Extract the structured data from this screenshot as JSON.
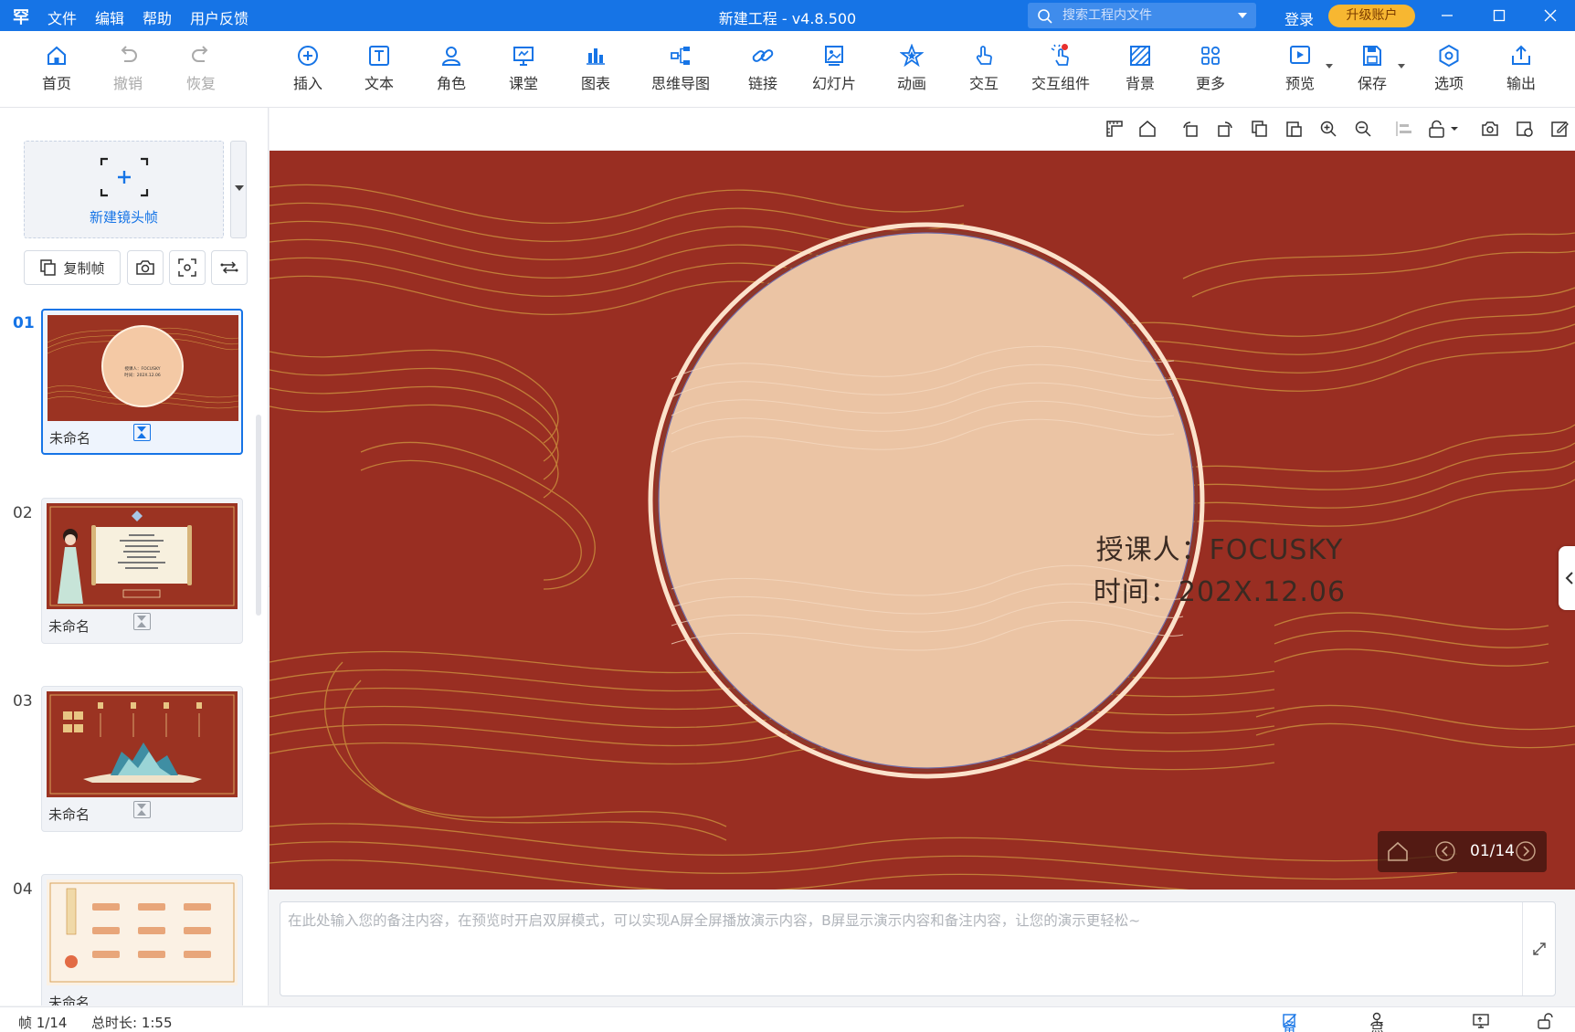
{
  "app": {
    "logo": "罕",
    "title": "新建工程 - v4.8.500",
    "menu": [
      "文件",
      "编辑",
      "帮助",
      "用户反馈"
    ],
    "search_placeholder": "搜索工程内文件",
    "login": "登录",
    "upgrade": "升级账户",
    "accent": "#1674e6"
  },
  "toolbar": [
    {
      "label": "首页",
      "icon": "home-icon"
    },
    {
      "label": "撤销",
      "icon": "undo-icon",
      "disabled": true
    },
    {
      "label": "恢复",
      "icon": "redo-icon",
      "disabled": true
    },
    {
      "label": "插入",
      "icon": "insert-plus-icon"
    },
    {
      "label": "文本",
      "icon": "text-icon"
    },
    {
      "label": "角色",
      "icon": "character-icon"
    },
    {
      "label": "课堂",
      "icon": "classroom-icon"
    },
    {
      "label": "图表",
      "icon": "chart-icon"
    },
    {
      "label": "思维导图",
      "icon": "mindmap-icon"
    },
    {
      "label": "链接",
      "icon": "link-icon"
    },
    {
      "label": "幻灯片",
      "icon": "slides-icon"
    },
    {
      "label": "动画",
      "icon": "animation-star-icon"
    },
    {
      "label": "交互",
      "icon": "interaction-hand-icon"
    },
    {
      "label": "交互组件",
      "icon": "interactive-widget-icon"
    },
    {
      "label": "背景",
      "icon": "background-icon"
    },
    {
      "label": "更多",
      "icon": "more-grid-icon"
    },
    {
      "label": "预览",
      "icon": "preview-play-icon"
    },
    {
      "label": "保存",
      "icon": "save-icon"
    },
    {
      "label": "选项",
      "icon": "options-hexagon-icon"
    },
    {
      "label": "输出",
      "icon": "export-icon"
    }
  ],
  "panel": {
    "new_frame": "新建镜头帧",
    "copy_frame": "复制帧",
    "frames": [
      {
        "num": "01",
        "name": "未命名"
      },
      {
        "num": "02",
        "name": "未命名"
      },
      {
        "num": "03",
        "name": "未命名"
      },
      {
        "num": "04",
        "name": "未命名"
      }
    ]
  },
  "slide": {
    "lecturer": "授课人：FOCUSKY",
    "time": "时间：202X.12.06",
    "bg_color": "#992e22",
    "circle_color": "#ebc4a4",
    "page": "01/14"
  },
  "notes": {
    "placeholder": "在此处输入您的备注内容，在预览时开启双屏模式，可以实现A屏全屏播放演示内容，B屏显示演示内容和备注内容，让您的演示更轻松~"
  },
  "status": {
    "frame": "帧 1/14",
    "duration": "总时长: 1:55",
    "notes_btn": "备注",
    "rollcall_btn": "点名"
  }
}
